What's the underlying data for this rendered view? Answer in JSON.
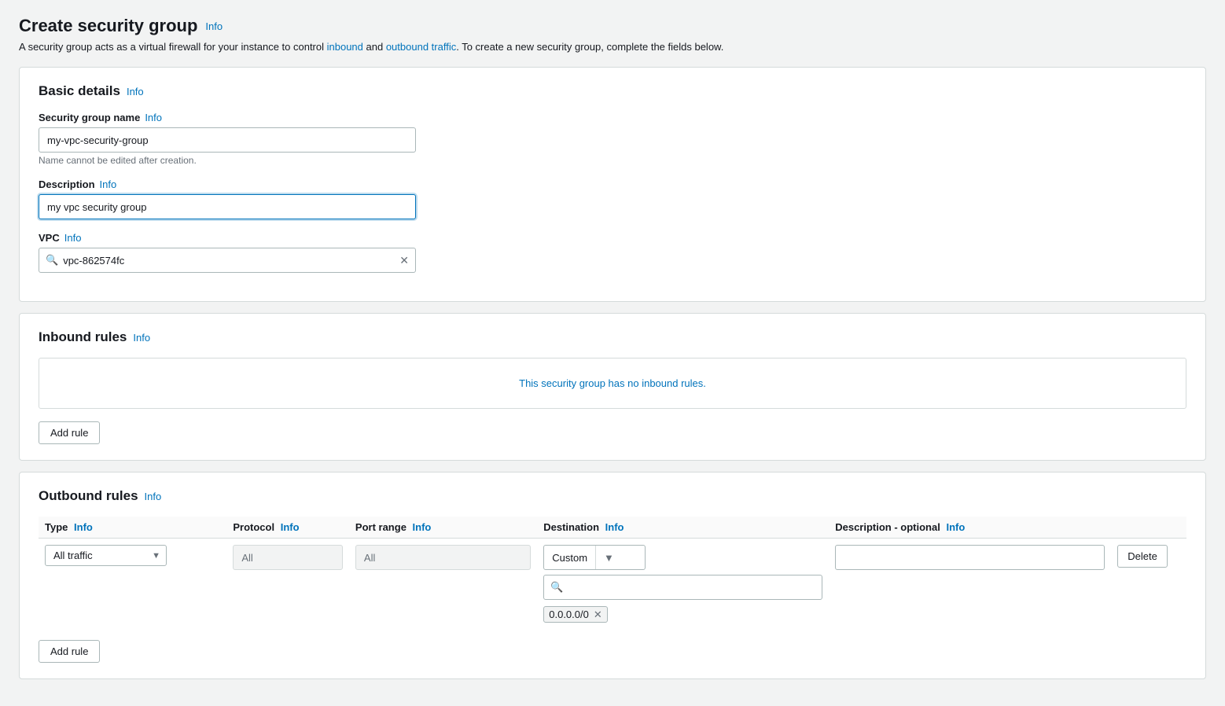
{
  "page": {
    "title": "Create security group",
    "info_link": "Info",
    "description_parts": [
      "A security group acts as a virtual firewall for your instance to control ",
      "inbound",
      " and ",
      "outbound traffic",
      ". To create a new security group, complete the fields below."
    ]
  },
  "basic_details": {
    "section_title": "Basic details",
    "info_link": "Info",
    "security_group_name": {
      "label": "Security group name",
      "info": "Info",
      "value": "my-vpc-security-group",
      "hint": "Name cannot be edited after creation."
    },
    "description": {
      "label": "Description",
      "info": "Info",
      "value": "my vpc security group"
    },
    "vpc": {
      "label": "VPC",
      "info": "Info",
      "value": "vpc-862574fc",
      "placeholder": ""
    }
  },
  "inbound_rules": {
    "section_title": "Inbound rules",
    "info_link": "Info",
    "empty_message": "This security group has no inbound rules.",
    "add_rule_label": "Add rule"
  },
  "outbound_rules": {
    "section_title": "Outbound rules",
    "info_link": "Info",
    "columns": [
      {
        "key": "type",
        "label": "Type",
        "info": "Info"
      },
      {
        "key": "protocol",
        "label": "Protocol",
        "info": "Info"
      },
      {
        "key": "port_range",
        "label": "Port range",
        "info": "Info"
      },
      {
        "key": "destination",
        "label": "Destination",
        "info": "Info"
      },
      {
        "key": "description",
        "label": "Description - optional",
        "info": "Info"
      },
      {
        "key": "actions",
        "label": ""
      }
    ],
    "rows": [
      {
        "type": "All traffic",
        "protocol": "All",
        "port_range": "All",
        "destination_type": "Custom",
        "destination_search": "",
        "destination_tags": [
          "0.0.0.0/0"
        ],
        "description": "",
        "delete_label": "Delete"
      }
    ],
    "add_rule_label": "Add rule"
  }
}
